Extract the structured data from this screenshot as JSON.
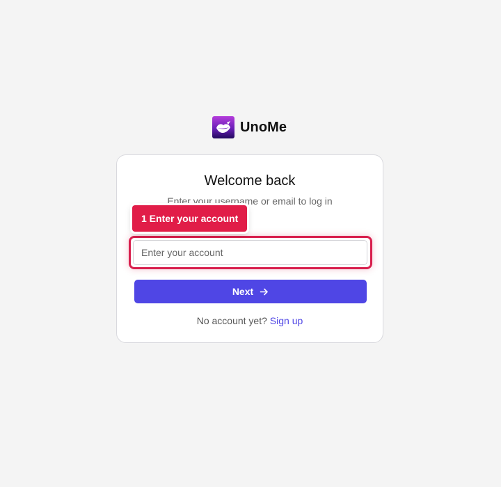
{
  "brand": {
    "name": "UnoMe",
    "logo_icon": "lips-logo-icon"
  },
  "login": {
    "title": "Welcome back",
    "subtitle": "Enter your username or email to log in",
    "account_placeholder": "Enter your account",
    "account_value": "",
    "next_label": "Next",
    "next_icon": "arrow-right-icon",
    "footer_text": "No account yet?",
    "signup_label": "Sign up"
  },
  "annotation": {
    "callout_label": "1 Enter your account"
  },
  "colors": {
    "background": "#f4f4f4",
    "primary": "#4f46e5",
    "highlight": "#d81f4d",
    "callout": "#e11d48"
  }
}
